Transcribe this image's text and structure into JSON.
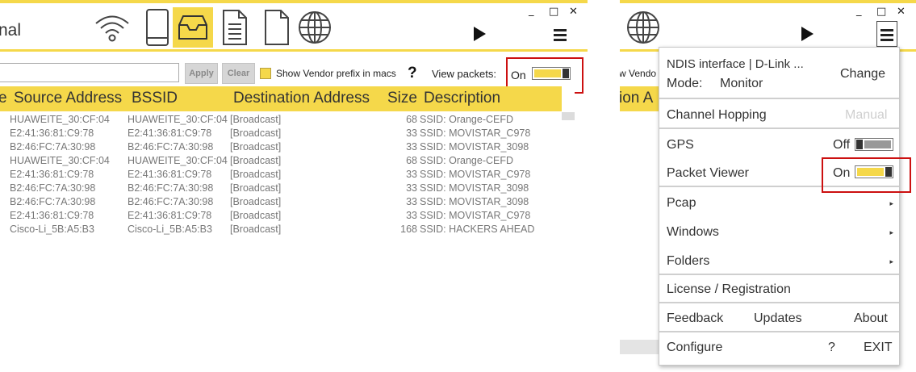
{
  "left_window": {
    "title_fragment": "nal",
    "toolbar": {
      "icons": [
        "wifi-icon",
        "phone-icon",
        "inbox-icon",
        "document-icon",
        "blank-document-icon",
        "globe-icon"
      ]
    },
    "window_controls": {
      "minimize": "_",
      "maximize": "□",
      "close": "✕"
    },
    "filter": {
      "apply_label": "Apply",
      "clear_label": "Clear",
      "vendor_label": "Show Vendor prefix in macs",
      "help_label": "?",
      "view_packets_label": "View packets:",
      "view_packets_state": "On"
    },
    "table": {
      "columns": {
        "type_fragment": "e",
        "source": "Source Address",
        "bssid": "BSSID",
        "destination": "Destination Address",
        "size": "Size",
        "description": "Description"
      },
      "rows": [
        {
          "source": "HUAWEITE_30:CF:04",
          "bssid": "HUAWEITE_30:CF:04",
          "destination": "[Broadcast]",
          "size": "68",
          "description": "SSID: Orange-CEFD"
        },
        {
          "source": "E2:41:36:81:C9:78",
          "bssid": "E2:41:36:81:C9:78",
          "destination": "[Broadcast]",
          "size": "33",
          "description": "SSID: MOVISTAR_C978"
        },
        {
          "source": "B2:46:FC:7A:30:98",
          "bssid": "B2:46:FC:7A:30:98",
          "destination": "[Broadcast]",
          "size": "33",
          "description": "SSID: MOVISTAR_3098"
        },
        {
          "source": "HUAWEITE_30:CF:04",
          "bssid": "HUAWEITE_30:CF:04",
          "destination": "[Broadcast]",
          "size": "68",
          "description": "SSID: Orange-CEFD"
        },
        {
          "source": "E2:41:36:81:C9:78",
          "bssid": "E2:41:36:81:C9:78",
          "destination": "[Broadcast]",
          "size": "33",
          "description": "SSID: MOVISTAR_C978"
        },
        {
          "source": "B2:46:FC:7A:30:98",
          "bssid": "B2:46:FC:7A:30:98",
          "destination": "[Broadcast]",
          "size": "33",
          "description": "SSID: MOVISTAR_3098"
        },
        {
          "source": "B2:46:FC:7A:30:98",
          "bssid": "B2:46:FC:7A:30:98",
          "destination": "[Broadcast]",
          "size": "33",
          "description": "SSID: MOVISTAR_3098"
        },
        {
          "source": "E2:41:36:81:C9:78",
          "bssid": "E2:41:36:81:C9:78",
          "destination": "[Broadcast]",
          "size": "33",
          "description": "SSID: MOVISTAR_C978"
        },
        {
          "source": "Cisco-Li_5B:A5:B3",
          "bssid": "Cisco-Li_5B:A5:B3",
          "destination": "[Broadcast]",
          "size": "168",
          "description": "SSID: HACKERS AHEAD"
        }
      ]
    }
  },
  "right_window": {
    "window_controls": {
      "minimize": "_",
      "maximize": "□",
      "close": "✕"
    },
    "behind_text": {
      "vendor_fragment": "w Vendo",
      "column_fragment": "ion A"
    },
    "menu": {
      "interface_label": "NDIS interface | D-Link ...",
      "mode_label": "Mode:",
      "mode_value": "Monitor",
      "change_label": "Change",
      "channel_hopping_label": "Channel Hopping",
      "channel_hopping_value": "Manual",
      "gps_label": "GPS",
      "gps_state": "Off",
      "packet_viewer_label": "Packet Viewer",
      "packet_viewer_state": "On",
      "pcap_label": "Pcap",
      "windows_label": "Windows",
      "folders_label": "Folders",
      "license_label": "License / Registration",
      "feedback_label": "Feedback",
      "updates_label": "Updates",
      "about_label": "About",
      "configure_label": "Configure",
      "help_label": "?",
      "exit_label": "EXIT",
      "submenu_arrow": "▸"
    }
  },
  "colors": {
    "accent_yellow": "#f5d84a",
    "highlight_red": "#cc1010",
    "toggle_off_gray": "#999999"
  }
}
